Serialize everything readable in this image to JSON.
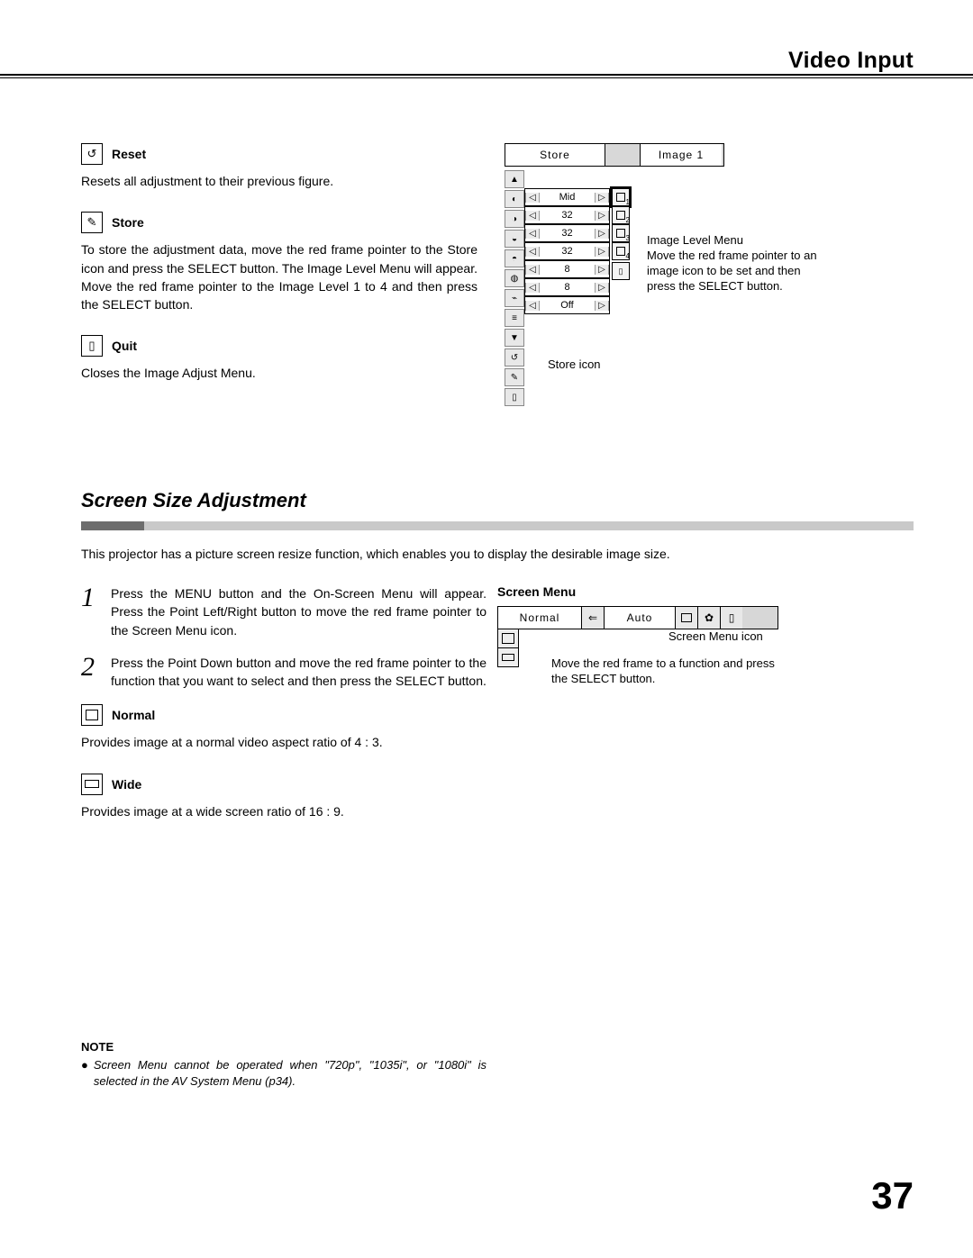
{
  "header": {
    "title": "Video Input"
  },
  "reset": {
    "title": "Reset",
    "desc": "Resets all adjustment to their previous figure."
  },
  "store": {
    "title": "Store",
    "desc": "To store the adjustment data, move the red frame pointer to the Store icon and press the SELECT button.  The Image Level Menu will appear.  Move the red frame pointer to the Image Level 1 to 4 and then press the SELECT button."
  },
  "quit": {
    "title": "Quit",
    "desc": "Closes the Image Adjust Menu."
  },
  "osd": {
    "tab1": "Store",
    "tab2": "Image 1",
    "rows": [
      {
        "val": "Mid"
      },
      {
        "val": "32"
      },
      {
        "val": "32"
      },
      {
        "val": "32"
      },
      {
        "val": "8"
      },
      {
        "val": "8"
      },
      {
        "val": "Off"
      }
    ],
    "side_labels": [
      "1",
      "2",
      "3",
      "4"
    ],
    "callout1": "Image Level Menu\nMove the red frame pointer to an image icon to be set and then press the SELECT button.",
    "callout2": "Store icon"
  },
  "section2": {
    "heading": "Screen Size Adjustment",
    "intro": "This projector has a picture screen resize function, which enables you to display the desirable image size.",
    "step1": "Press the MENU button and the On-Screen Menu will appear. Press the Point Left/Right button to move the red frame pointer to the Screen Menu icon.",
    "step2": "Press the Point Down button and move the red frame pointer to the function that you want to select and then press the SELECT button.",
    "num1": "1",
    "num2": "2"
  },
  "normal": {
    "title": "Normal",
    "desc": "Provides image at a normal video aspect ratio of 4 : 3."
  },
  "wide": {
    "title": "Wide",
    "desc": "Provides image at a wide screen ratio of 16 : 9."
  },
  "screen_menu": {
    "heading": "Screen Menu",
    "bar_c0": "Normal",
    "bar_c2": "Auto",
    "callout1": "Screen Menu icon",
    "callout2": "Move the red frame to a function and press the SELECT button."
  },
  "note": {
    "heading": "NOTE",
    "text": "Screen Menu cannot be operated when \"720p\", \"1035i\", or \"1080i\" is selected in the AV System Menu (p34)."
  },
  "page_number": "37"
}
